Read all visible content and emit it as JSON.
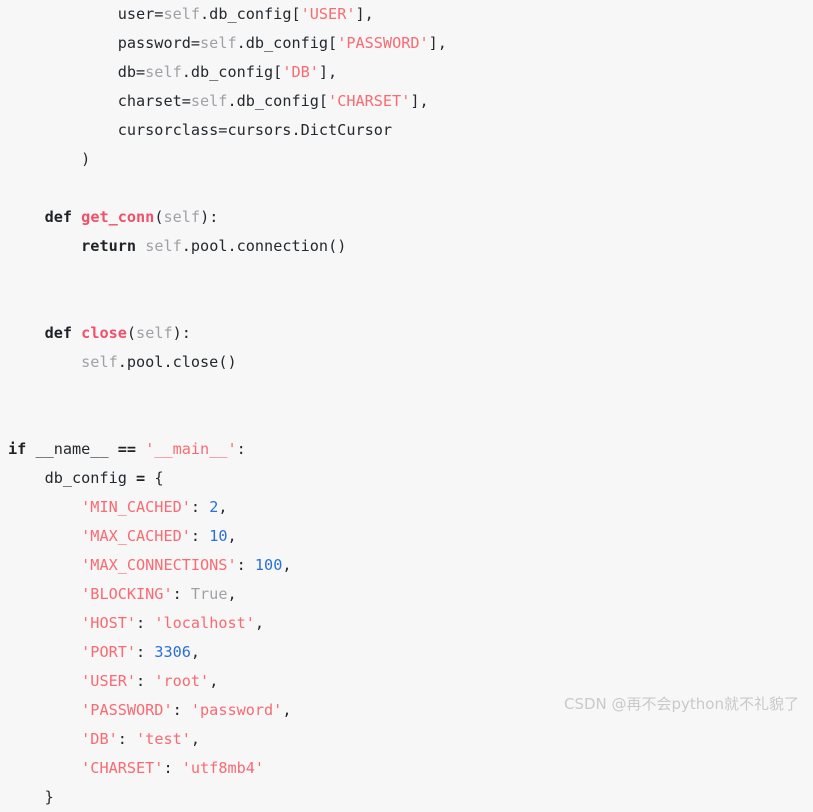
{
  "editor": {
    "language": "python",
    "background_color": "#f7f7f7",
    "colors": {
      "plain": "#24292e",
      "keyword": "#1f2328",
      "function": "#f2506a",
      "string": "#fa6a72",
      "number": "#2a6fdb",
      "builtin": "#a0a1a7",
      "watermark": "#c9c9c9"
    }
  },
  "code": {
    "lines": [
      {
        "id": "line-user-arg",
        "text": "            user=self.db_config['USER'],",
        "tokens": [
          {
            "t": "            user=",
            "c": "tok-plain"
          },
          {
            "t": "self",
            "c": "tok-self"
          },
          {
            "t": ".db_config[",
            "c": "tok-plain"
          },
          {
            "t": "'USER'",
            "c": "tok-str"
          },
          {
            "t": "],",
            "c": "tok-plain"
          }
        ]
      },
      {
        "id": "line-password-arg",
        "text": "            password=self.db_config['PASSWORD'],",
        "tokens": [
          {
            "t": "            password=",
            "c": "tok-plain"
          },
          {
            "t": "self",
            "c": "tok-self"
          },
          {
            "t": ".db_config[",
            "c": "tok-plain"
          },
          {
            "t": "'PASSWORD'",
            "c": "tok-str"
          },
          {
            "t": "],",
            "c": "tok-plain"
          }
        ]
      },
      {
        "id": "line-db-arg",
        "text": "            db=self.db_config['DB'],",
        "tokens": [
          {
            "t": "            db=",
            "c": "tok-plain"
          },
          {
            "t": "self",
            "c": "tok-self"
          },
          {
            "t": ".db_config[",
            "c": "tok-plain"
          },
          {
            "t": "'DB'",
            "c": "tok-str"
          },
          {
            "t": "],",
            "c": "tok-plain"
          }
        ]
      },
      {
        "id": "line-charset-arg",
        "text": "            charset=self.db_config['CHARSET'],",
        "tokens": [
          {
            "t": "            charset=",
            "c": "tok-plain"
          },
          {
            "t": "self",
            "c": "tok-self"
          },
          {
            "t": ".db_config[",
            "c": "tok-plain"
          },
          {
            "t": "'CHARSET'",
            "c": "tok-str"
          },
          {
            "t": "],",
            "c": "tok-plain"
          }
        ]
      },
      {
        "id": "line-cursorclass-arg",
        "text": "            cursorclass=cursors.DictCursor",
        "tokens": [
          {
            "t": "            cursorclass=cursors.DictCursor",
            "c": "tok-plain"
          }
        ]
      },
      {
        "id": "line-close-paren",
        "text": "        )",
        "tokens": [
          {
            "t": "        )",
            "c": "tok-plain"
          }
        ]
      },
      {
        "id": "line-blank-1",
        "text": "",
        "tokens": []
      },
      {
        "id": "line-def-get-conn",
        "text": "    def get_conn(self):",
        "tokens": [
          {
            "t": "    ",
            "c": "tok-plain"
          },
          {
            "t": "def",
            "c": "tok-kw"
          },
          {
            "t": " ",
            "c": "tok-plain"
          },
          {
            "t": "get_conn",
            "c": "tok-fn"
          },
          {
            "t": "(",
            "c": "tok-plain"
          },
          {
            "t": "self",
            "c": "tok-self"
          },
          {
            "t": "):",
            "c": "tok-plain"
          }
        ]
      },
      {
        "id": "line-return-connection",
        "text": "        return self.pool.connection()",
        "tokens": [
          {
            "t": "        ",
            "c": "tok-plain"
          },
          {
            "t": "return",
            "c": "tok-kw"
          },
          {
            "t": " ",
            "c": "tok-plain"
          },
          {
            "t": "self",
            "c": "tok-self"
          },
          {
            "t": ".pool.connection()",
            "c": "tok-plain"
          }
        ]
      },
      {
        "id": "line-blank-2",
        "text": "",
        "tokens": []
      },
      {
        "id": "line-blank-3",
        "text": "",
        "tokens": []
      },
      {
        "id": "line-def-close",
        "text": "    def close(self):",
        "tokens": [
          {
            "t": "    ",
            "c": "tok-plain"
          },
          {
            "t": "def",
            "c": "tok-kw"
          },
          {
            "t": " ",
            "c": "tok-plain"
          },
          {
            "t": "close",
            "c": "tok-fn"
          },
          {
            "t": "(",
            "c": "tok-plain"
          },
          {
            "t": "self",
            "c": "tok-self"
          },
          {
            "t": "):",
            "c": "tok-plain"
          }
        ]
      },
      {
        "id": "line-pool-close",
        "text": "        self.pool.close()",
        "tokens": [
          {
            "t": "        ",
            "c": "tok-plain"
          },
          {
            "t": "self",
            "c": "tok-self"
          },
          {
            "t": ".pool.close()",
            "c": "tok-plain"
          }
        ]
      },
      {
        "id": "line-blank-4",
        "text": "",
        "tokens": []
      },
      {
        "id": "line-blank-5",
        "text": "",
        "tokens": []
      },
      {
        "id": "line-if-main",
        "text": "if __name__ == '__main__':",
        "tokens": [
          {
            "t": "if",
            "c": "tok-kw"
          },
          {
            "t": " __name__ ",
            "c": "tok-plain"
          },
          {
            "t": "==",
            "c": "tok-op"
          },
          {
            "t": " ",
            "c": "tok-plain"
          },
          {
            "t": "'__main__'",
            "c": "tok-str"
          },
          {
            "t": ":",
            "c": "tok-plain"
          }
        ]
      },
      {
        "id": "line-db-config-open",
        "text": "    db_config = {",
        "tokens": [
          {
            "t": "    db_config ",
            "c": "tok-plain"
          },
          {
            "t": "=",
            "c": "tok-op"
          },
          {
            "t": " {",
            "c": "tok-plain"
          }
        ]
      },
      {
        "id": "line-min-cached",
        "text": "        'MIN_CACHED': 2,",
        "tokens": [
          {
            "t": "        ",
            "c": "tok-plain"
          },
          {
            "t": "'MIN_CACHED'",
            "c": "tok-str"
          },
          {
            "t": ": ",
            "c": "tok-plain"
          },
          {
            "t": "2",
            "c": "tok-num"
          },
          {
            "t": ",",
            "c": "tok-plain"
          }
        ]
      },
      {
        "id": "line-max-cached",
        "text": "        'MAX_CACHED': 10,",
        "tokens": [
          {
            "t": "        ",
            "c": "tok-plain"
          },
          {
            "t": "'MAX_CACHED'",
            "c": "tok-str"
          },
          {
            "t": ": ",
            "c": "tok-plain"
          },
          {
            "t": "10",
            "c": "tok-num"
          },
          {
            "t": ",",
            "c": "tok-plain"
          }
        ]
      },
      {
        "id": "line-max-connections",
        "text": "        'MAX_CONNECTIONS': 100,",
        "tokens": [
          {
            "t": "        ",
            "c": "tok-plain"
          },
          {
            "t": "'MAX_CONNECTIONS'",
            "c": "tok-str"
          },
          {
            "t": ": ",
            "c": "tok-plain"
          },
          {
            "t": "100",
            "c": "tok-num"
          },
          {
            "t": ",",
            "c": "tok-plain"
          }
        ]
      },
      {
        "id": "line-blocking",
        "text": "        'BLOCKING': True,",
        "tokens": [
          {
            "t": "        ",
            "c": "tok-plain"
          },
          {
            "t": "'BLOCKING'",
            "c": "tok-str"
          },
          {
            "t": ": ",
            "c": "tok-plain"
          },
          {
            "t": "True",
            "c": "tok-builtin"
          },
          {
            "t": ",",
            "c": "tok-plain"
          }
        ]
      },
      {
        "id": "line-host",
        "text": "        'HOST': 'localhost',",
        "tokens": [
          {
            "t": "        ",
            "c": "tok-plain"
          },
          {
            "t": "'HOST'",
            "c": "tok-str"
          },
          {
            "t": ": ",
            "c": "tok-plain"
          },
          {
            "t": "'localhost'",
            "c": "tok-str"
          },
          {
            "t": ",",
            "c": "tok-plain"
          }
        ]
      },
      {
        "id": "line-port",
        "text": "        'PORT': 3306,",
        "tokens": [
          {
            "t": "        ",
            "c": "tok-plain"
          },
          {
            "t": "'PORT'",
            "c": "tok-str"
          },
          {
            "t": ": ",
            "c": "tok-plain"
          },
          {
            "t": "3306",
            "c": "tok-num"
          },
          {
            "t": ",",
            "c": "tok-plain"
          }
        ]
      },
      {
        "id": "line-user",
        "text": "        'USER': 'root',",
        "tokens": [
          {
            "t": "        ",
            "c": "tok-plain"
          },
          {
            "t": "'USER'",
            "c": "tok-str"
          },
          {
            "t": ": ",
            "c": "tok-plain"
          },
          {
            "t": "'root'",
            "c": "tok-str"
          },
          {
            "t": ",",
            "c": "tok-plain"
          }
        ]
      },
      {
        "id": "line-password",
        "text": "        'PASSWORD': 'password',",
        "tokens": [
          {
            "t": "        ",
            "c": "tok-plain"
          },
          {
            "t": "'PASSWORD'",
            "c": "tok-str"
          },
          {
            "t": ": ",
            "c": "tok-plain"
          },
          {
            "t": "'password'",
            "c": "tok-str"
          },
          {
            "t": ",",
            "c": "tok-plain"
          }
        ]
      },
      {
        "id": "line-db",
        "text": "        'DB': 'test',",
        "tokens": [
          {
            "t": "        ",
            "c": "tok-plain"
          },
          {
            "t": "'DB'",
            "c": "tok-str"
          },
          {
            "t": ": ",
            "c": "tok-plain"
          },
          {
            "t": "'test'",
            "c": "tok-str"
          },
          {
            "t": ",",
            "c": "tok-plain"
          }
        ]
      },
      {
        "id": "line-charset",
        "text": "        'CHARSET': 'utf8mb4'",
        "tokens": [
          {
            "t": "        ",
            "c": "tok-plain"
          },
          {
            "t": "'CHARSET'",
            "c": "tok-str"
          },
          {
            "t": ": ",
            "c": "tok-plain"
          },
          {
            "t": "'utf8mb4'",
            "c": "tok-str"
          }
        ]
      },
      {
        "id": "line-dict-close",
        "text": "    }",
        "tokens": [
          {
            "t": "    }",
            "c": "tok-plain"
          }
        ]
      }
    ]
  },
  "watermark": {
    "text": "CSDN @再不会python就不礼貌了"
  }
}
